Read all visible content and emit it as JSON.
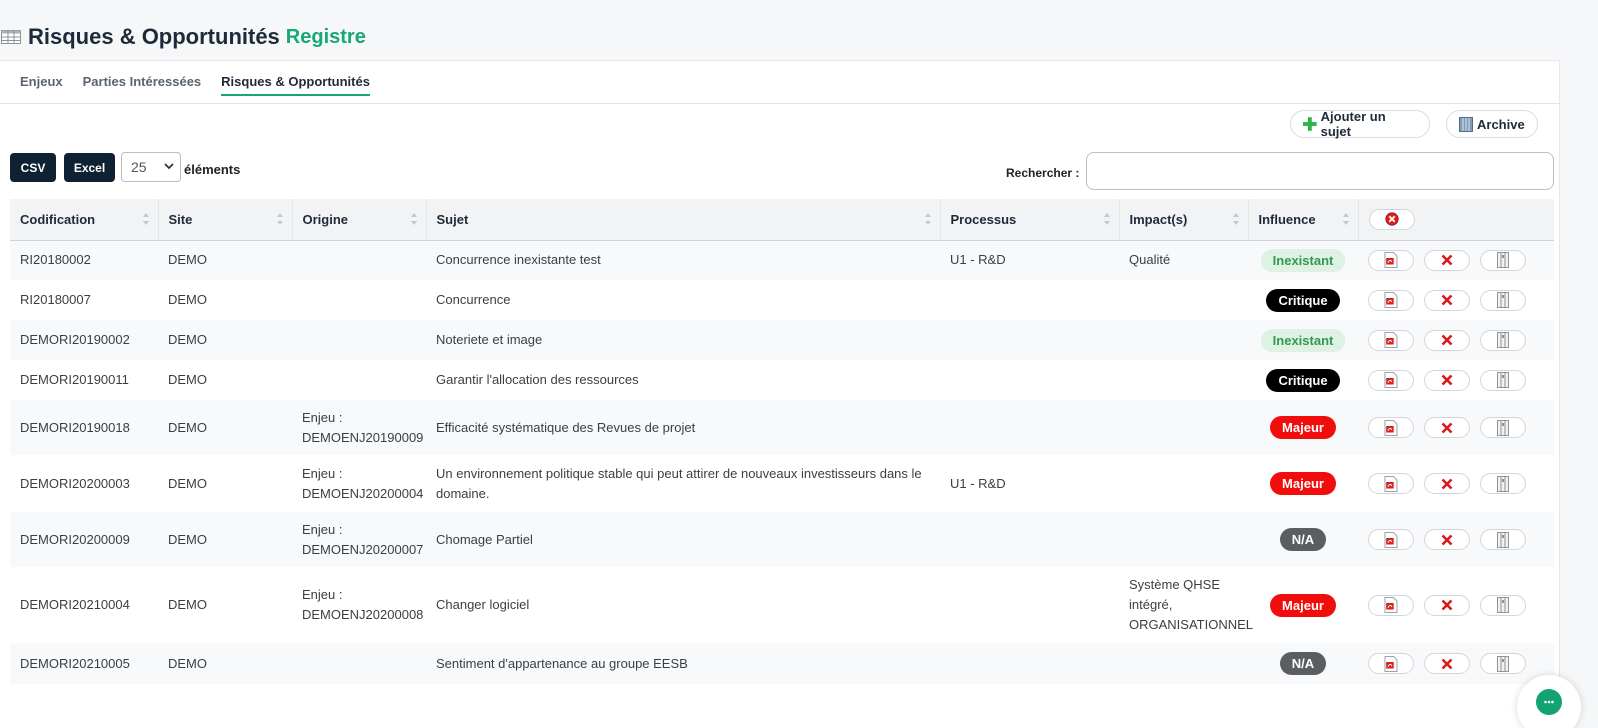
{
  "header": {
    "title": "Risques & Opportunités",
    "accent": "Registre"
  },
  "tabs": [
    {
      "label": "Enjeux",
      "active": false
    },
    {
      "label": "Parties Intéressées",
      "active": false
    },
    {
      "label": "Risques & Opportunités",
      "active": true
    }
  ],
  "actions": {
    "add_label": "Ajouter un sujet",
    "archive_label": "Archive"
  },
  "toolbar": {
    "csv_label": "CSV",
    "excel_label": "Excel",
    "page_size": "25",
    "elements_label": "éléments",
    "search_label": "Rechercher :"
  },
  "columns": [
    "Codification",
    "Site",
    "Origine",
    "Sujet",
    "Processus",
    "Impact(s)",
    "Influence"
  ],
  "rows": [
    {
      "code": "RI20180002",
      "site": "DEMO",
      "origine": "",
      "sujet": "Concurrence inexistante test",
      "processus": "U1 - R&D",
      "impacts": "Qualité",
      "influence": "Inexistant",
      "level": "inexistant"
    },
    {
      "code": "RI20180007",
      "site": "DEMO",
      "origine": "",
      "sujet": "Concurrence",
      "processus": "",
      "impacts": "",
      "influence": "Critique",
      "level": "critique"
    },
    {
      "code": "DEMORI20190002",
      "site": "DEMO",
      "origine": "",
      "sujet": "Noteriete et image",
      "processus": "",
      "impacts": "",
      "influence": "Inexistant",
      "level": "inexistant"
    },
    {
      "code": "DEMORI20190011",
      "site": "DEMO",
      "origine": "",
      "sujet": "Garantir l'allocation des ressources",
      "processus": "",
      "impacts": "",
      "influence": "Critique",
      "level": "critique"
    },
    {
      "code": "DEMORI20190018",
      "site": "DEMO",
      "origine": "Enjeu : DEMOENJ20190009",
      "sujet": "Efficacité systématique des Revues de projet",
      "processus": "",
      "impacts": "",
      "influence": "Majeur",
      "level": "majeur"
    },
    {
      "code": "DEMORI20200003",
      "site": "DEMO",
      "origine": "Enjeu : DEMOENJ20200004",
      "sujet": "Un environnement politique stable qui peut attirer de nouveaux investisseurs dans le domaine.",
      "processus": "U1 - R&D",
      "impacts": "",
      "influence": "Majeur",
      "level": "majeur"
    },
    {
      "code": "DEMORI20200009",
      "site": "DEMO",
      "origine": "Enjeu : DEMOENJ20200007",
      "sujet": "Chomage Partiel",
      "processus": "",
      "impacts": "",
      "influence": "N/A",
      "level": "na"
    },
    {
      "code": "DEMORI20210004",
      "site": "DEMO",
      "origine": "Enjeu : DEMOENJ20200008",
      "sujet": "Changer logiciel",
      "processus": "",
      "impacts": "Système QHSE intégré, ORGANISATIONNEL",
      "influence": "Majeur",
      "level": "majeur"
    },
    {
      "code": "DEMORI20210005",
      "site": "DEMO",
      "origine": "",
      "sujet": "Sentiment d'appartenance au groupe EESB",
      "processus": "",
      "impacts": "",
      "influence": "N/A",
      "level": "na"
    }
  ],
  "colors": {
    "accent": "#18a877",
    "dark": "#0f2233",
    "majeur": "#f20d0d",
    "critique": "#000000",
    "na": "#5a5d61",
    "inexistant_bg": "#dff1e4",
    "inexistant_fg": "#2f9a4d"
  }
}
